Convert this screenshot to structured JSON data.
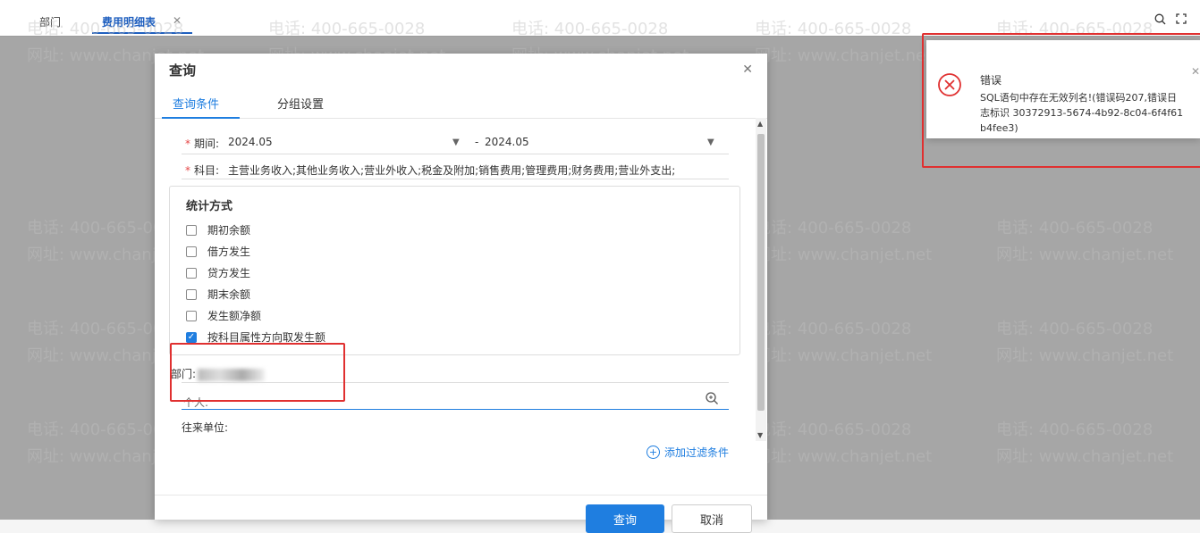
{
  "tabs": [
    {
      "label": "部门"
    },
    {
      "label": "费用明细表"
    }
  ],
  "dialog": {
    "title": "查询",
    "tabs": [
      "查询条件",
      "分组设置"
    ],
    "period_label": "期间:",
    "period_from": "2024.05",
    "period_sep": "-",
    "period_to": "2024.05",
    "subject_label": "科目:",
    "subject_value": "主营业务收入;其他业务收入;营业外收入;税金及附加;销售费用;管理费用;财务费用;营业外支出;",
    "stat_title": "统计方式",
    "stat_options": [
      {
        "label": "期初余额",
        "checked": false
      },
      {
        "label": "借方发生",
        "checked": false
      },
      {
        "label": "贷方发生",
        "checked": false
      },
      {
        "label": "期末余额",
        "checked": false
      },
      {
        "label": "发生额净额",
        "checked": false
      },
      {
        "label": "按科目属性方向取发生额",
        "checked": true
      }
    ],
    "dept_label": "部门:",
    "dept_value_fragment": "部门",
    "person_label": "个人:",
    "partner_label": "往来单位:",
    "add_filter": "添加过滤条件",
    "query_btn": "查询",
    "cancel_btn": "取消"
  },
  "notification": {
    "title": "错误",
    "message": "SQL语句中存在无效列名!(错误码207,错误日志标识 30372913-5674-4b92-8c04-6f4f61b4fee3)"
  },
  "watermark": {
    "phone": "电话: 400-665-0028",
    "site": "网址: www.chanjet.net"
  },
  "colors": {
    "accent": "#1f7ee0",
    "error": "#e03030",
    "required": "#e54545"
  }
}
